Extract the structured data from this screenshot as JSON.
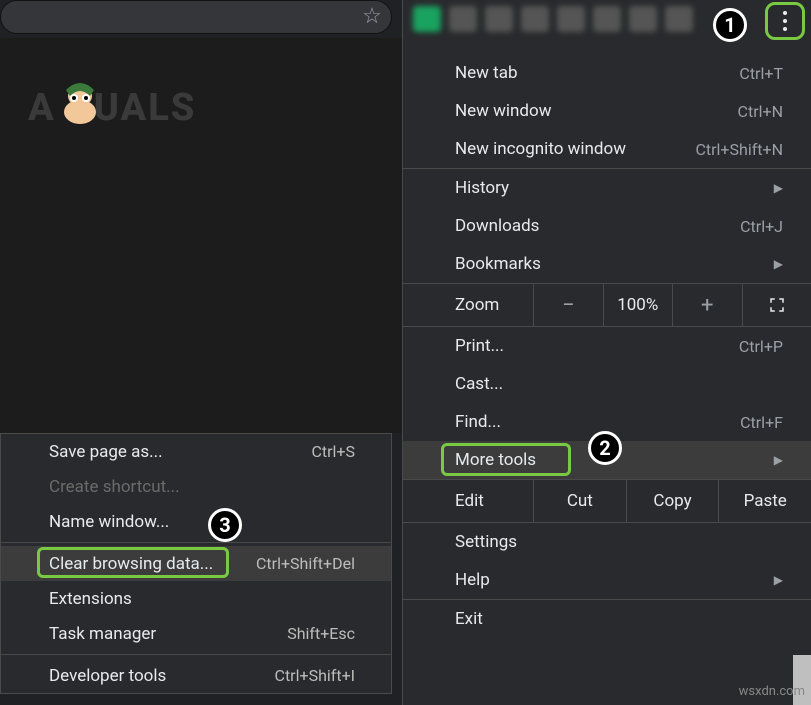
{
  "colors": {
    "highlight": "#7ac943"
  },
  "addr": {
    "star_tooltip": "Bookmark this tab"
  },
  "logo": {
    "text": "A   PUALS"
  },
  "menu": {
    "new_tab": {
      "label": "New tab",
      "shortcut": "Ctrl+T"
    },
    "new_window": {
      "label": "New window",
      "shortcut": "Ctrl+N"
    },
    "new_incognito": {
      "label": "New incognito window",
      "shortcut": "Ctrl+Shift+N"
    },
    "history": {
      "label": "History"
    },
    "downloads": {
      "label": "Downloads",
      "shortcut": "Ctrl+J"
    },
    "bookmarks": {
      "label": "Bookmarks"
    },
    "zoom": {
      "label": "Zoom",
      "minus": "−",
      "level": "100%",
      "plus": "+"
    },
    "print": {
      "label": "Print...",
      "shortcut": "Ctrl+P"
    },
    "cast": {
      "label": "Cast..."
    },
    "find": {
      "label": "Find...",
      "shortcut": "Ctrl+F"
    },
    "more_tools": {
      "label": "More tools"
    },
    "edit": {
      "label": "Edit",
      "cut": "Cut",
      "copy": "Copy",
      "paste": "Paste"
    },
    "settings": {
      "label": "Settings"
    },
    "help": {
      "label": "Help"
    },
    "exit": {
      "label": "Exit"
    }
  },
  "submenu": {
    "save_page": {
      "label": "Save page as...",
      "shortcut": "Ctrl+S"
    },
    "create_shortcut": {
      "label": "Create shortcut..."
    },
    "name_window": {
      "label": "Name window..."
    },
    "clear_browsing": {
      "label": "Clear browsing data...",
      "shortcut": "Ctrl+Shift+Del"
    },
    "extensions": {
      "label": "Extensions"
    },
    "task_manager": {
      "label": "Task manager",
      "shortcut": "Shift+Esc"
    },
    "developer_tools": {
      "label": "Developer tools",
      "shortcut": "Ctrl+Shift+I"
    }
  },
  "annotations": {
    "one": "1",
    "two": "2",
    "three": "3"
  },
  "source": "wsxdn.com"
}
